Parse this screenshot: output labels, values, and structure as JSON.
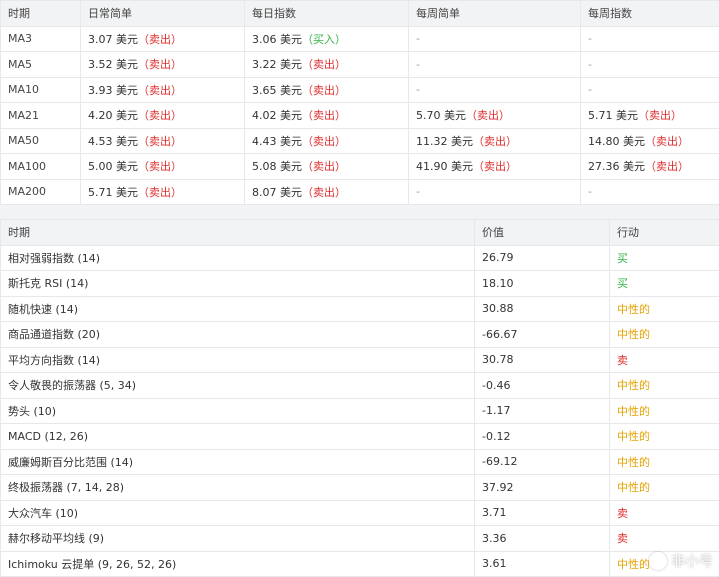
{
  "moving_averages": {
    "headers": [
      "时期",
      "日常简单",
      "每日指数",
      "每周简单",
      "每周指数"
    ],
    "currency": "美元",
    "rows": [
      {
        "period": "MA3",
        "daily_simple": "3.07",
        "daily_simple_action": "（卖出）",
        "daily_exp": "3.06",
        "daily_exp_action": "（买入）",
        "weekly_simple": "-",
        "weekly_simple_action": "",
        "weekly_exp": "-",
        "weekly_exp_action": ""
      },
      {
        "period": "MA5",
        "daily_simple": "3.52",
        "daily_simple_action": "（卖出）",
        "daily_exp": "3.22",
        "daily_exp_action": "（卖出）",
        "weekly_simple": "-",
        "weekly_simple_action": "",
        "weekly_exp": "-",
        "weekly_exp_action": ""
      },
      {
        "period": "MA10",
        "daily_simple": "3.93",
        "daily_simple_action": "（卖出）",
        "daily_exp": "3.65",
        "daily_exp_action": "（卖出）",
        "weekly_simple": "-",
        "weekly_simple_action": "",
        "weekly_exp": "-",
        "weekly_exp_action": ""
      },
      {
        "period": "MA21",
        "daily_simple": "4.20",
        "daily_simple_action": "（卖出）",
        "daily_exp": "4.02",
        "daily_exp_action": "（卖出）",
        "weekly_simple": "5.70",
        "weekly_simple_action": "（卖出）",
        "weekly_exp": "5.71",
        "weekly_exp_action": "（卖出）"
      },
      {
        "period": "MA50",
        "daily_simple": "4.53",
        "daily_simple_action": "（卖出）",
        "daily_exp": "4.43",
        "daily_exp_action": "（卖出）",
        "weekly_simple": "11.32",
        "weekly_simple_action": "（卖出）",
        "weekly_exp": "14.80",
        "weekly_exp_action": "（卖出）"
      },
      {
        "period": "MA100",
        "daily_simple": "5.00",
        "daily_simple_action": "（卖出）",
        "daily_exp": "5.08",
        "daily_exp_action": "（卖出）",
        "weekly_simple": "41.90",
        "weekly_simple_action": "（卖出）",
        "weekly_exp": "27.36",
        "weekly_exp_action": "（卖出）"
      },
      {
        "period": "MA200",
        "daily_simple": "5.71",
        "daily_simple_action": "（卖出）",
        "daily_exp": "8.07",
        "daily_exp_action": "（卖出）",
        "weekly_simple": "-",
        "weekly_simple_action": "",
        "weekly_exp": "-",
        "weekly_exp_action": ""
      }
    ]
  },
  "oscillators": {
    "headers": [
      "时期",
      "价值",
      "行动"
    ],
    "rows": [
      {
        "name": "相对强弱指数 (14)",
        "value": "26.79",
        "action": "买",
        "kind": "buy"
      },
      {
        "name": "斯托克 RSI (14)",
        "value": "18.10",
        "action": "买",
        "kind": "buy"
      },
      {
        "name": "随机快速 (14)",
        "value": "30.88",
        "action": "中性的",
        "kind": "neutral"
      },
      {
        "name": "商品通道指数 (20)",
        "value": "-66.67",
        "action": "中性的",
        "kind": "neutral"
      },
      {
        "name": "平均方向指数 (14)",
        "value": "30.78",
        "action": "卖",
        "kind": "sell"
      },
      {
        "name": "令人敬畏的振荡器 (5, 34)",
        "value": "-0.46",
        "action": "中性的",
        "kind": "neutral"
      },
      {
        "name": "势头 (10)",
        "value": "-1.17",
        "action": "中性的",
        "kind": "neutral"
      },
      {
        "name": "MACD (12, 26)",
        "value": "-0.12",
        "action": "中性的",
        "kind": "neutral"
      },
      {
        "name": "威廉姆斯百分比范围 (14)",
        "value": "-69.12",
        "action": "中性的",
        "kind": "neutral"
      },
      {
        "name": "终极振荡器 (7, 14, 28)",
        "value": "37.92",
        "action": "中性的",
        "kind": "neutral"
      },
      {
        "name": "大众汽车 (10)",
        "value": "3.71",
        "action": "卖",
        "kind": "sell"
      },
      {
        "name": "赫尔移动平均线 (9)",
        "value": "3.36",
        "action": "卖",
        "kind": "sell"
      },
      {
        "name": "Ichimoku 云提单 (9, 26, 52, 26)",
        "value": "3.61",
        "action": "中性的",
        "kind": "neutral"
      }
    ]
  },
  "colors": {
    "sell": "#e02d2d",
    "buy": "#2fb344",
    "neutral": "#e5a200"
  },
  "watermark": {
    "text": "非小号",
    "icon": "feixiaohao-logo-icon"
  }
}
